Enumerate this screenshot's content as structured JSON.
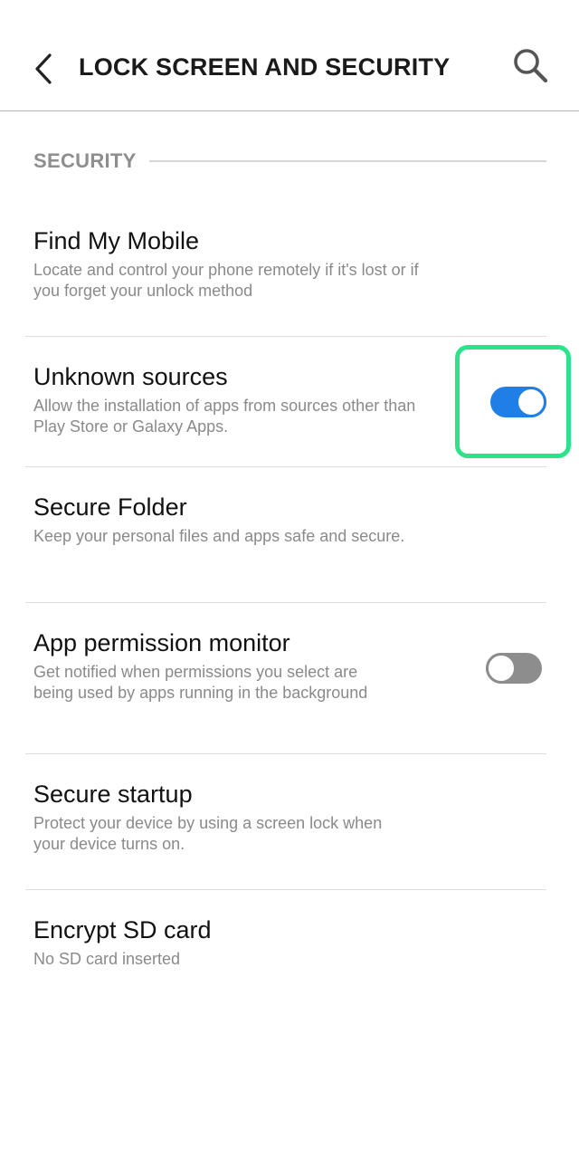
{
  "header": {
    "title": "LOCK SCREEN AND SECURITY",
    "back_icon": "chevron-left-icon",
    "search_icon": "search-icon"
  },
  "section": {
    "label": "SECURITY"
  },
  "items": [
    {
      "title": "Find My Mobile",
      "subtitle": "Locate and control your phone remotely if it's lost or if you forget your unlock method"
    },
    {
      "title": "Unknown sources",
      "subtitle": "Allow the installation of apps from sources other than Play Store or Galaxy Apps.",
      "toggle": "on"
    },
    {
      "title": "Secure Folder",
      "subtitle": "Keep your personal files and apps safe and secure."
    },
    {
      "title": "App permission monitor",
      "subtitle": "Get notified when permissions you select are being used by apps running in the background",
      "toggle": "off"
    },
    {
      "title": "Secure startup",
      "subtitle": "Protect your device by using a screen lock when your device turns on."
    },
    {
      "title": "Encrypt SD card",
      "subtitle": "No SD card inserted"
    }
  ],
  "colors": {
    "toggle_on": "#1f7fe6",
    "toggle_off": "#8d8d8d",
    "highlight": "#2ee28c"
  }
}
